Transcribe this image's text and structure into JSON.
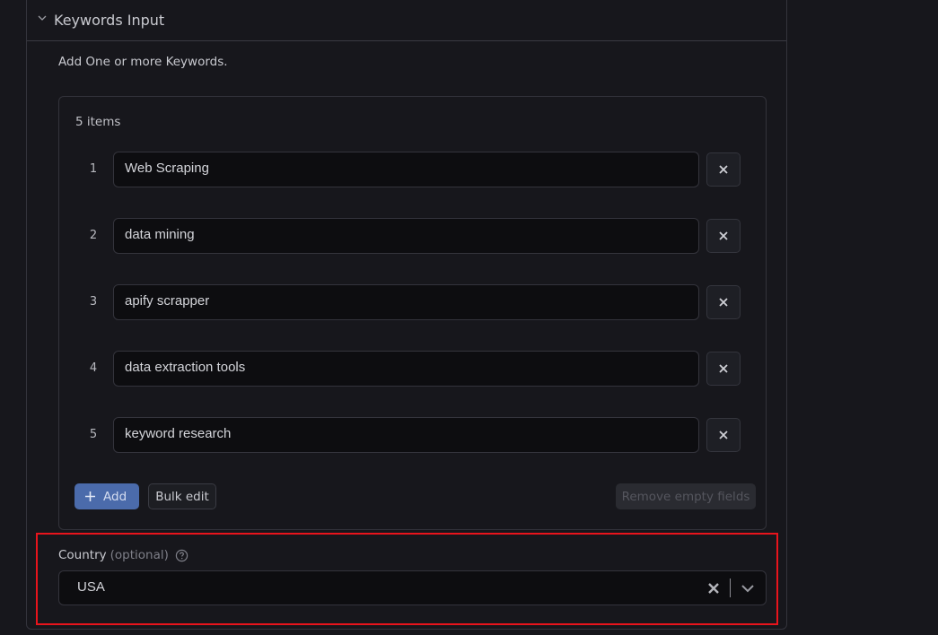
{
  "section": {
    "title": "Keywords Input",
    "description": "Add One or more Keywords."
  },
  "keywords": {
    "count_label": "5 items",
    "items": [
      {
        "index": "1",
        "value": "Web Scraping"
      },
      {
        "index": "2",
        "value": "data mining"
      },
      {
        "index": "3",
        "value": "apify scrapper"
      },
      {
        "index": "4",
        "value": "data extraction tools"
      },
      {
        "index": "5",
        "value": "keyword research"
      }
    ],
    "add_label": "Add",
    "bulk_edit_label": "Bulk edit",
    "remove_empty_label": "Remove empty fields"
  },
  "country": {
    "label": "Country",
    "optional_label": "(optional)",
    "value": "USA"
  },
  "colors": {
    "accent": "#4b6bab",
    "highlight": "#e8141c",
    "background": "#17171c"
  }
}
